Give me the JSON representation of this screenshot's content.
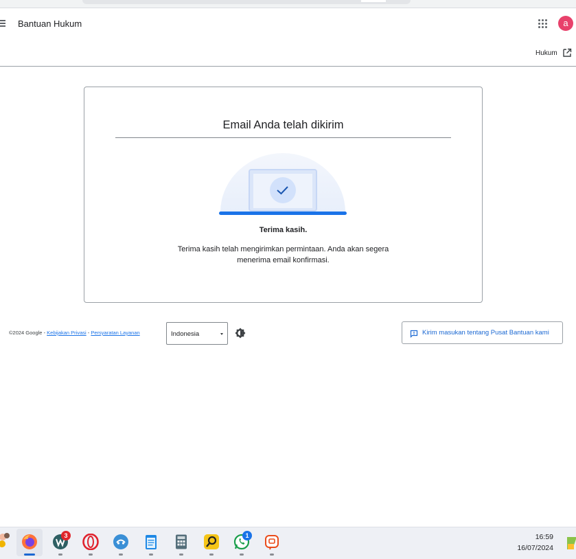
{
  "header": {
    "title": "Bantuan Hukum",
    "avatar_initial": "a",
    "avatar_color": "#e8416b"
  },
  "subbar": {
    "hukum_label": "Hukum"
  },
  "card": {
    "title": "Email Anda telah dikirim",
    "thanks_heading": "Terima kasih.",
    "thanks_body": "Terima kasih telah mengirimkan permintaan. Anda akan segera menerima email konfirmasi."
  },
  "footer": {
    "copyright": "©2024 Google",
    "separator": " - ",
    "privacy_link": "Kebijakan Privasi",
    "terms_link": "Persyaratan Layanan",
    "language_selected": "Indonesia",
    "feedback_label": "Kirim masukan tentang Pusat Bantuan kami",
    "link_color": "#1a73e8"
  },
  "taskbar": {
    "apps": [
      {
        "name": "firefox",
        "icon": "firefox-icon",
        "badge": ""
      },
      {
        "name": "app-badge",
        "icon": "app-icon",
        "badge": "3"
      },
      {
        "name": "opera",
        "icon": "opera-icon",
        "badge": ""
      },
      {
        "name": "chat-blue",
        "icon": "chat-bubble-icon",
        "badge": ""
      },
      {
        "name": "notepad",
        "icon": "notepad-icon",
        "badge": ""
      },
      {
        "name": "calculator",
        "icon": "calculator-icon",
        "badge": ""
      },
      {
        "name": "search-app",
        "icon": "search-app-icon",
        "badge": ""
      },
      {
        "name": "whatsapp",
        "icon": "whatsapp-icon",
        "badge": "1"
      },
      {
        "name": "orange-chat",
        "icon": "orange-chat-icon",
        "badge": ""
      }
    ],
    "time": "16:59",
    "date": "16/07/2024"
  }
}
